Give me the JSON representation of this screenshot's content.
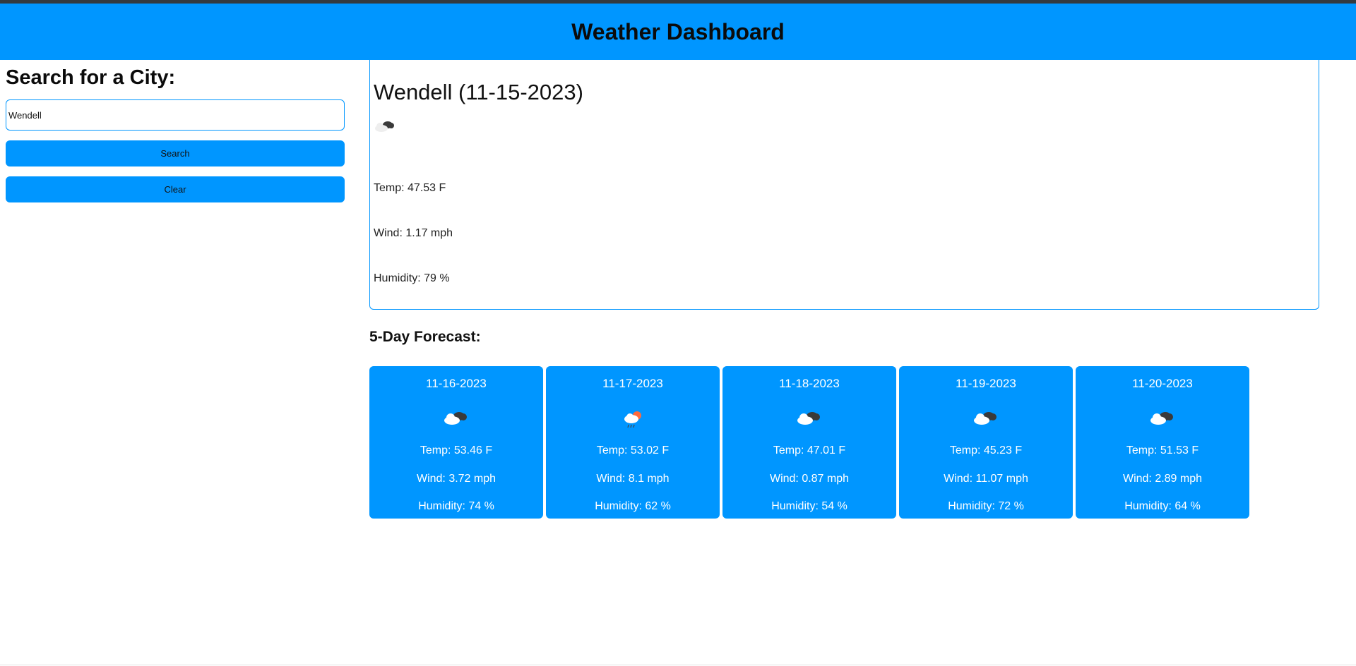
{
  "header": {
    "title": "Weather Dashboard"
  },
  "sidebar": {
    "heading": "Search for a City:",
    "search_value": "Wendell",
    "search_button": "Search",
    "clear_button": "Clear"
  },
  "current": {
    "title": "Wendell (11-15-2023)",
    "icon": "broken-clouds-icon",
    "temp": "Temp: 47.53 F",
    "wind": "Wind: 1.17 mph",
    "humidity": "Humidity: 79 %"
  },
  "forecast": {
    "title": "5-Day Forecast:",
    "days": [
      {
        "date": "11-16-2023",
        "icon": "broken-clouds-icon",
        "temp": "Temp: 53.46 F",
        "wind": "Wind: 3.72 mph",
        "humidity": "Humidity: 74 %"
      },
      {
        "date": "11-17-2023",
        "icon": "rain-sun-icon",
        "temp": "Temp: 53.02 F",
        "wind": "Wind: 8.1 mph",
        "humidity": "Humidity: 62 %"
      },
      {
        "date": "11-18-2023",
        "icon": "broken-clouds-icon",
        "temp": "Temp: 47.01 F",
        "wind": "Wind: 0.87 mph",
        "humidity": "Humidity: 54 %"
      },
      {
        "date": "11-19-2023",
        "icon": "broken-clouds-icon",
        "temp": "Temp: 45.23 F",
        "wind": "Wind: 11.07 mph",
        "humidity": "Humidity: 72 %"
      },
      {
        "date": "11-20-2023",
        "icon": "broken-clouds-icon",
        "temp": "Temp: 51.53 F",
        "wind": "Wind: 2.89 mph",
        "humidity": "Humidity: 64 %"
      }
    ]
  },
  "colors": {
    "accent": "#0096ff",
    "text": "#111111",
    "card_text": "#ffffff"
  }
}
